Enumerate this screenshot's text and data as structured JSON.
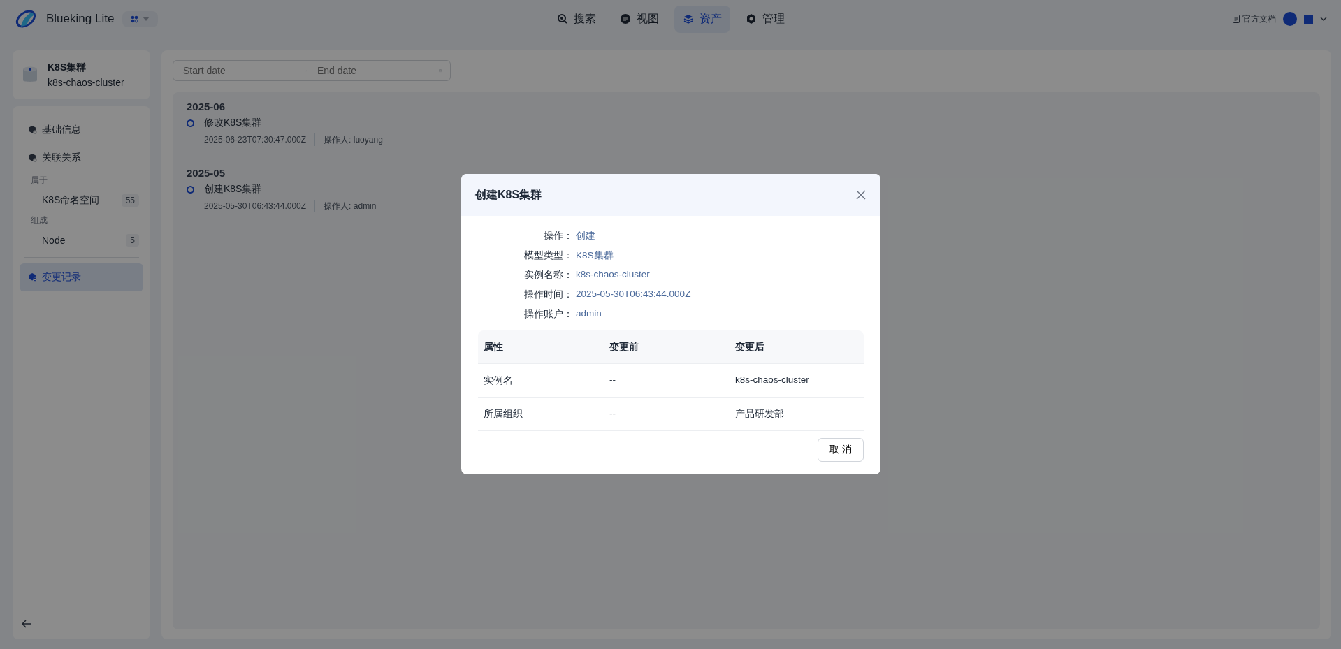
{
  "app": {
    "name": "Blueking Lite"
  },
  "nav": {
    "tabs": [
      {
        "label": "搜索",
        "selected": false
      },
      {
        "label": "视图",
        "selected": false
      },
      {
        "label": "资产",
        "selected": true
      },
      {
        "label": "管理",
        "selected": false
      }
    ]
  },
  "header_right": {
    "docs_link": "官方文档"
  },
  "sidebar": {
    "model": "K8S集群",
    "instance": "k8s-chaos-cluster",
    "items": [
      {
        "kind": "nav",
        "label": "基础信息",
        "selected": false
      },
      {
        "kind": "nav",
        "label": "关联关系",
        "selected": false
      },
      {
        "kind": "group",
        "label": "属于"
      },
      {
        "kind": "relation",
        "label": "K8S命名空间",
        "count": "55"
      },
      {
        "kind": "group",
        "label": "组成"
      },
      {
        "kind": "relation",
        "label": "Node",
        "count": "5"
      },
      {
        "kind": "divider"
      },
      {
        "kind": "nav",
        "label": "变更记录",
        "selected": true
      }
    ]
  },
  "date_range": {
    "start_placeholder": "Start date",
    "end_placeholder": "End date"
  },
  "timeline": {
    "groups": [
      {
        "month": "2025-06",
        "entries": [
          {
            "title": "修改K8S集群",
            "time": "2025-06-23T07:30:47.000Z",
            "operator": "操作人: luoyang"
          }
        ]
      },
      {
        "month": "2025-05",
        "entries": [
          {
            "title": "创建K8S集群",
            "time": "2025-05-30T06:43:44.000Z",
            "operator": "操作人: admin"
          }
        ]
      }
    ]
  },
  "dialog": {
    "title": "创建K8S集群",
    "fields": [
      {
        "label": "操作：",
        "value": "创建"
      },
      {
        "label": "模型类型：",
        "value": "K8S集群"
      },
      {
        "label": "实例名称：",
        "value": "k8s-chaos-cluster"
      },
      {
        "label": "操作时间：",
        "value": "2025-05-30T06:43:44.000Z"
      },
      {
        "label": "操作账户：",
        "value": "admin"
      }
    ],
    "table": {
      "columns": [
        "属性",
        "变更前",
        "变更后"
      ],
      "rows": [
        [
          "实例名",
          "--",
          "k8s-chaos-cluster"
        ],
        [
          "所属组织",
          "--",
          "产品研发部"
        ]
      ]
    },
    "cancel_button": "取 消"
  }
}
